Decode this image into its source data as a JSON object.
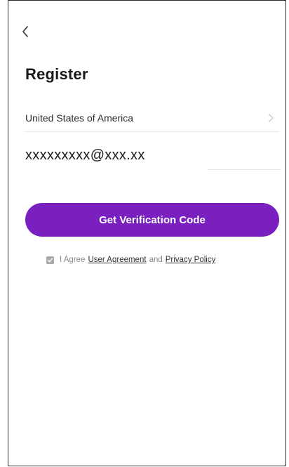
{
  "header": {
    "back_icon": "chevron-left-icon",
    "title": "Register"
  },
  "form": {
    "country": {
      "label": "United States of America",
      "icon": "chevron-right-icon"
    },
    "email": {
      "value": "xxxxxxxxx@xxx.xx"
    },
    "verify_button_label": "Get Verification Code"
  },
  "agreement": {
    "checked": true,
    "prefix": "I Agree",
    "user_agreement_link": "User Agreement",
    "conjunction": "and",
    "privacy_policy_link": "Privacy Policy"
  },
  "colors": {
    "accent": "#7a1fc0",
    "text": "#1a1a1a",
    "muted": "#8a8a8a"
  }
}
